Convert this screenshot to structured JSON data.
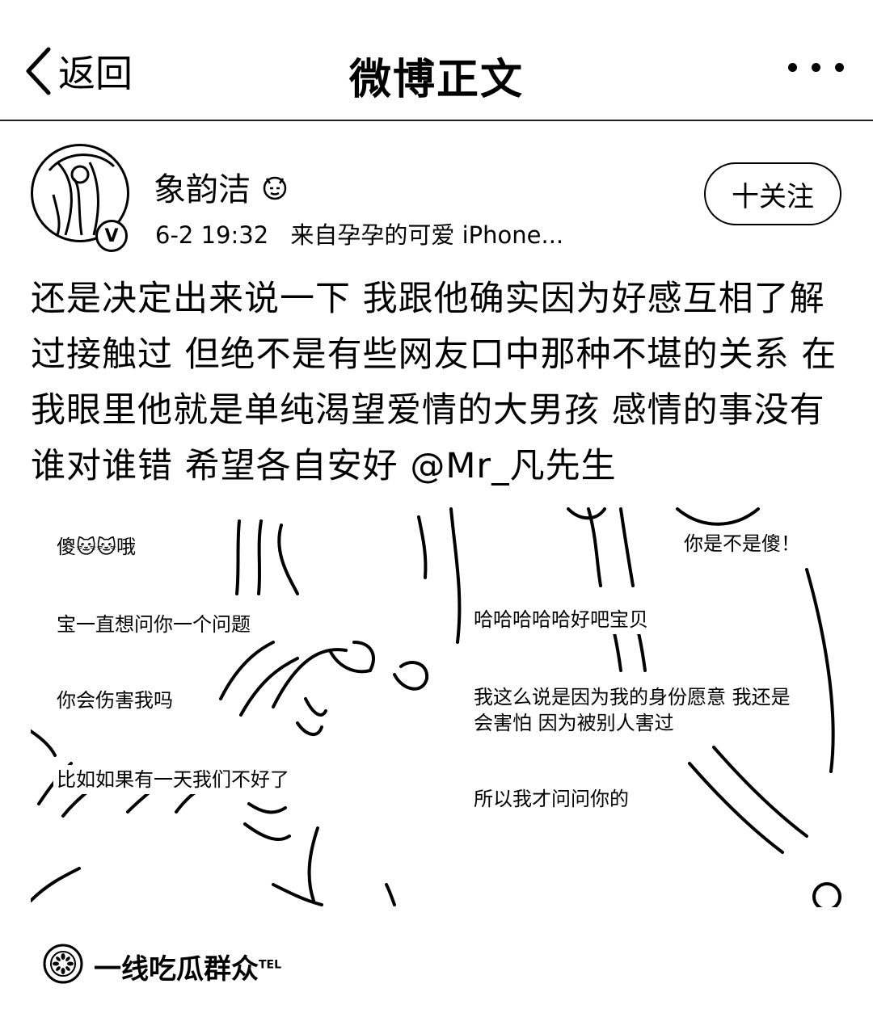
{
  "nav": {
    "back_label": "返回",
    "title": "微博正文"
  },
  "author": {
    "name": "象韵洁",
    "time": "6-2 19:32",
    "source": "来自孕孕的可爱 iPhone...",
    "verified_badge": "V",
    "follow_label": "十关注"
  },
  "post": {
    "text": "还是决定出来说一下 我跟他确实因为好感互相了解过接触过 但绝不是有些网友口中那种不堪的关系 在我眼里他就是单纯渴望爱情的大男孩 感情的事没有谁对谁错 希望各自安好 @Mr_凡先生"
  },
  "image_chat": {
    "left": [
      "傻🐱🐱哦",
      "宝一直想问你一个问题",
      "你会伤害我吗",
      "比如如果有一天我们不好了"
    ],
    "right": [
      "你是不是傻！",
      "哈哈哈哈哈好吧宝贝",
      "我这么说是因为我的身份愿意 我还是会害怕 因为被别人害过",
      "所以我才问问你的"
    ]
  },
  "watermark": {
    "text": "一线吃瓜群众",
    "sup": "TEL"
  }
}
